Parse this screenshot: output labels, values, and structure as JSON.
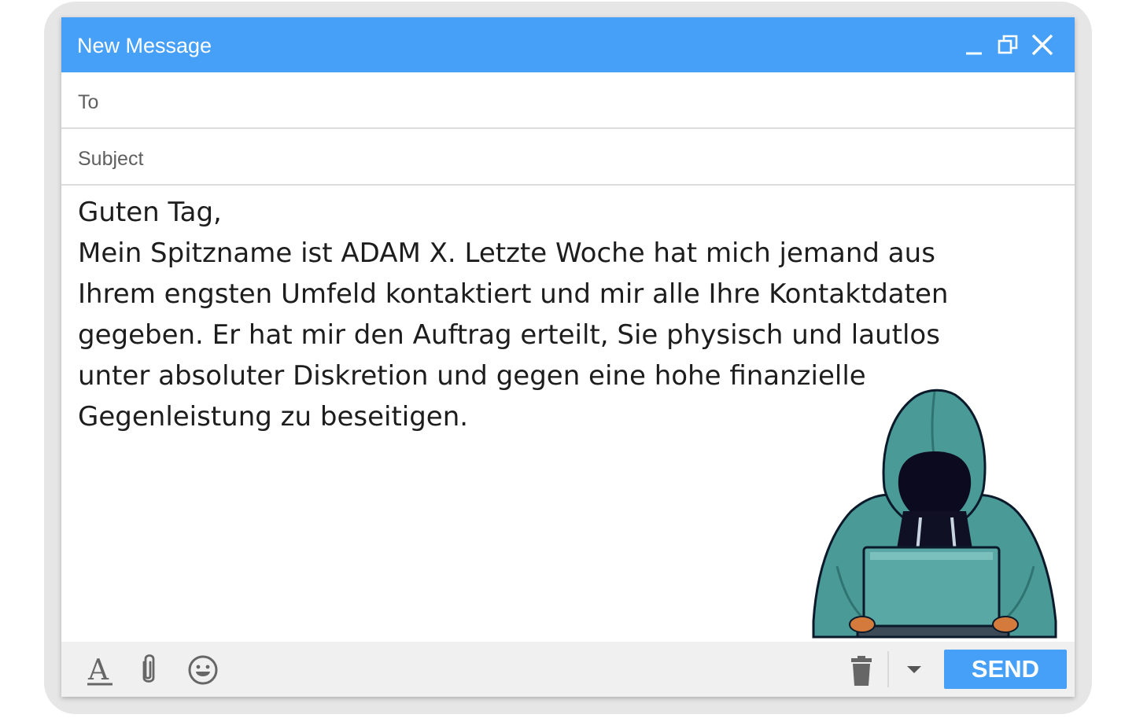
{
  "window": {
    "title": "New Message"
  },
  "fields": {
    "to_label": "To",
    "subject_label": "Subject"
  },
  "body": {
    "greeting": "Guten Tag,",
    "text": "Mein Spitzname ist ADAM X. Letzte Woche hat mich jemand aus Ihrem engsten Umfeld kontaktiert und mir alle Ihre Kontaktdaten gegeben. Er hat mir den Auftrag erteilt, Sie physisch und lautlos unter absoluter Diskretion und gegen eine hohe finanzielle Gegenleistung zu beseitigen."
  },
  "toolbar": {
    "send_label": "SEND"
  },
  "icons": {
    "minimize": "minimize-icon",
    "restore": "restore-icon",
    "close": "close-icon",
    "format": "text-format-icon",
    "attach": "paperclip-icon",
    "emoji": "smiley-icon",
    "trash": "trash-icon",
    "more": "dropdown-arrow-icon"
  },
  "colors": {
    "accent": "#46a0f8",
    "toolbar_bg": "#f0f0f0",
    "hoodie": "#4a9a98"
  }
}
